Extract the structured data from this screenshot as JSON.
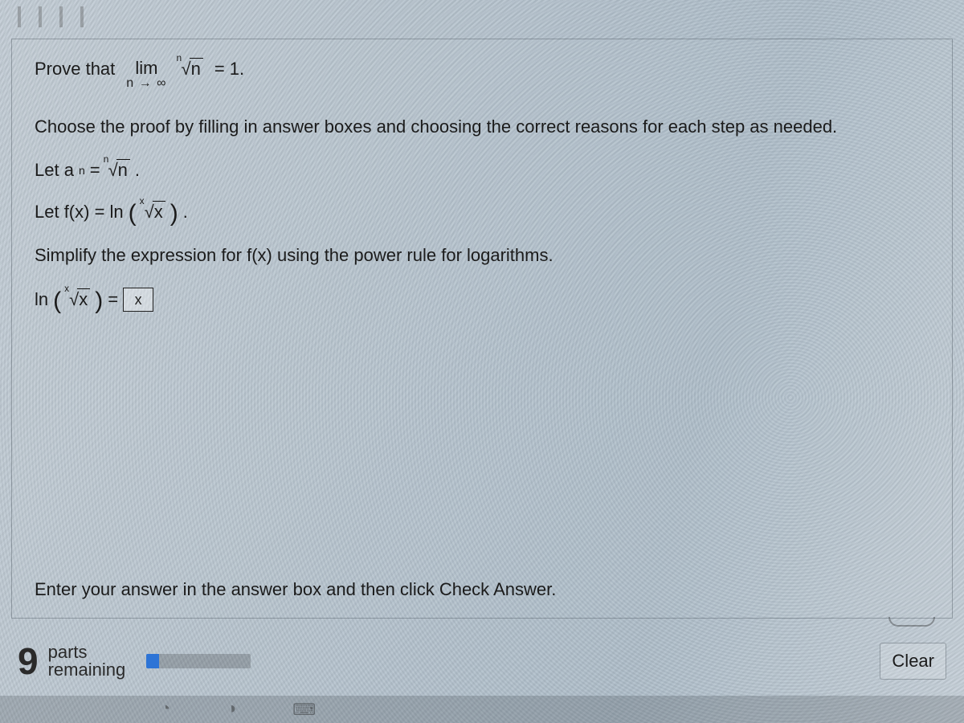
{
  "question": {
    "prompt_prefix": "Prove that",
    "limit_word": "lim",
    "limit_sub": "n → ∞",
    "root_index": "n",
    "root_radicand": "n",
    "equals_value": "= 1."
  },
  "instruction_main": "Choose the proof by filling in answer boxes and choosing the correct reasons for each step as needed.",
  "step_let_an": {
    "prefix": "Let a",
    "sub": "n",
    "equals": "=",
    "root_index": "n",
    "root_radicand": "n",
    "suffix": "."
  },
  "step_let_fx": {
    "prefix": "Let f(x) = ln",
    "root_index": "x",
    "root_radicand": "x",
    "suffix": "."
  },
  "step_simplify": "Simplify the expression for f(x) using the power rule for logarithms.",
  "step_answer_line": {
    "prefix": "ln",
    "root_index": "x",
    "root_radicand": "x",
    "equals": "=",
    "answer_placeholder": "x"
  },
  "instruction_bottom": "Enter your answer in the answer box and then click Check Answer.",
  "footer": {
    "parts_count": "9",
    "parts_label_top": "parts",
    "parts_label_bottom": "remaining",
    "clear_button": "Clear"
  }
}
